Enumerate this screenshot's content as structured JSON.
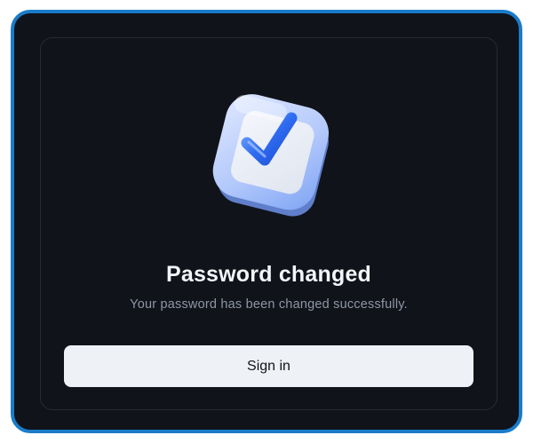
{
  "dialog": {
    "title": "Password changed",
    "message": "Your password has been changed successfully.",
    "sign_in_label": "Sign in"
  },
  "illustration": {
    "icon": "check-square-icon",
    "colors": {
      "square": "#eaf0fb",
      "edge": "#9ab7f7",
      "check": "#2f6bf0"
    }
  },
  "colors": {
    "frame_border": "#1a7cc9",
    "background": "#10131a",
    "card_border": "#272b34",
    "title": "#f3f5f9",
    "subtitle": "#8f96a3",
    "button_bg": "#eef1f6",
    "button_text": "#111318"
  }
}
